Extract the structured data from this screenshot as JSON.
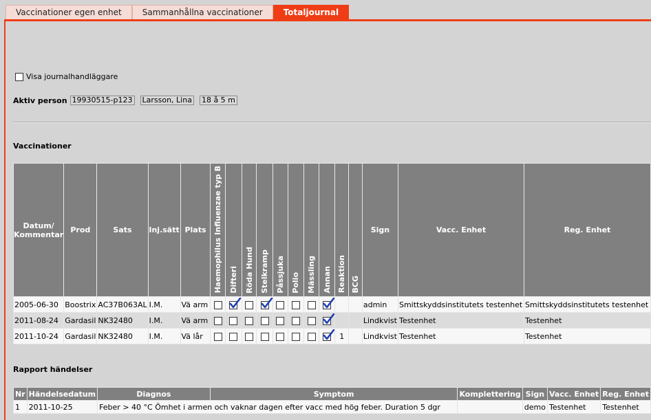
{
  "tabs": [
    {
      "label": "Vaccinationer egen enhet",
      "active": false
    },
    {
      "label": "Sammanhållna vaccinationer",
      "active": false
    },
    {
      "label": "Totaljournal",
      "active": true
    }
  ],
  "colors": {
    "accent": "#ef3d16",
    "header_bg": "#808080",
    "page_bg": "#d4d4d4",
    "check": "#1f3fb0"
  },
  "show_handlers": {
    "label": "Visa journalhandläggare",
    "checked": false
  },
  "active_person": {
    "label": "Aktiv person",
    "pnr": "19930515-p123",
    "name": "Larsson, Lina",
    "age": "18 å 5 m"
  },
  "vaccinations": {
    "title": "Vaccinationer",
    "headers": {
      "datum": "Datum/ Kommentar",
      "prod": "Prod",
      "sats": "Sats",
      "injsatt": "Inj.sätt",
      "plats": "Plats",
      "vaccines": [
        "Haemophilus Influenzae typ B",
        "Difteri",
        "Röda Hund",
        "Stelkramp",
        "Påssjuka",
        "Polio",
        "Mässling",
        "Annan"
      ],
      "reaktion": "Reaktion",
      "bcg": "BCG",
      "sign": "Sign",
      "vacc_enhet": "Vacc. Enhet",
      "reg_enhet": "Reg. Enhet"
    },
    "rows": [
      {
        "datum": "2005-06-30",
        "prod": "Boostrix",
        "sats": "AC37B063AL",
        "injsatt": "I.M.",
        "plats": "Vä arm",
        "vaccines": [
          false,
          true,
          false,
          true,
          false,
          false,
          false,
          true
        ],
        "reaktion": "",
        "bcg": "",
        "sign": "admin",
        "vacc_enhet": "Smittskyddsinstitutets testenhet",
        "reg_enhet": "Smittskyddsinstitutets testenhet"
      },
      {
        "datum": "2011-08-24",
        "prod": "Gardasil",
        "sats": "NK32480",
        "injsatt": "I.M.",
        "plats": "Vä arm",
        "vaccines": [
          false,
          false,
          false,
          false,
          false,
          false,
          false,
          true
        ],
        "reaktion": "",
        "bcg": "",
        "sign": "Lindkvist",
        "vacc_enhet": "Testenhet",
        "reg_enhet": "Testenhet"
      },
      {
        "datum": "2011-10-24",
        "prod": "Gardasil",
        "sats": "NK32480",
        "injsatt": "I.M.",
        "plats": "Vä lår",
        "vaccines": [
          false,
          false,
          false,
          false,
          false,
          false,
          false,
          true
        ],
        "reaktion": "1",
        "bcg": "",
        "sign": "Lindkvist",
        "vacc_enhet": "Testenhet",
        "reg_enhet": "Testenhet"
      }
    ]
  },
  "report": {
    "title": "Rapport händelser",
    "headers": [
      "Nr",
      "Händelsedatum",
      "Diagnos",
      "Symptom",
      "Komplettering",
      "Sign",
      "Vacc. Enhet",
      "Reg. Enhet"
    ],
    "rows": [
      {
        "nr": "1",
        "datum": "2011-10-25",
        "diagnos": "Feber > 40 °C Ömhet i armen och vaknar dagen efter vacc med hög feber. Duration 5 dgr",
        "symptom": "",
        "komplettering": "",
        "sign": "demo",
        "vacc_enhet": "Testenhet",
        "reg_enhet": "Testenhet"
      }
    ]
  }
}
